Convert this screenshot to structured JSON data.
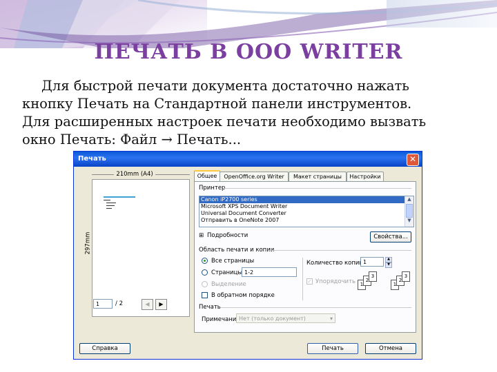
{
  "slide": {
    "title": "ПЕЧАТЬ В ООО WRITER",
    "paragraph": [
      "Для быстрой печати документа достаточно нажать",
      "кнопку Печать на Стандартной панели инструментов.",
      "Для расширенных настроек печати необходимо вызвать",
      "окно Печать: Файл → Печать..."
    ]
  },
  "dialog": {
    "title": "Печать",
    "close_glyph": "✕",
    "preview": {
      "width_label": "210mm (A4)",
      "height_label": "297mm",
      "page_value": "1",
      "page_of": "/ 2",
      "prev_glyph": "◀",
      "next_glyph": "▶"
    },
    "tabs": [
      "Общее",
      "OpenOffice.org Writer",
      "Макет страницы",
      "Настройки"
    ],
    "printer": {
      "section": "Принтер",
      "items": [
        "Canon iP2700 series",
        "Microsoft XPS Document Writer",
        "Universal Document Converter",
        "Отправить в OneNote 2007"
      ],
      "selected_index": 0,
      "details": "Подробности",
      "properties_button": "Свойства..."
    },
    "range": {
      "section": "Область печати и копии",
      "all_pages": "Все страницы",
      "pages": "Страницы",
      "pages_value": "1-2",
      "selection": "Выделение",
      "reverse": "В обратном порядке",
      "copies_label": "Количество копий",
      "copies_value": "1",
      "collate": "Упорядочить",
      "sheet_labels": [
        "1",
        "2",
        "3"
      ]
    },
    "print": {
      "section": "Печать",
      "comments_label": "Примечания",
      "comments_value": "Нет (только документ)"
    },
    "buttons": {
      "help": "Справка",
      "print": "Печать",
      "cancel": "Отмена"
    }
  }
}
